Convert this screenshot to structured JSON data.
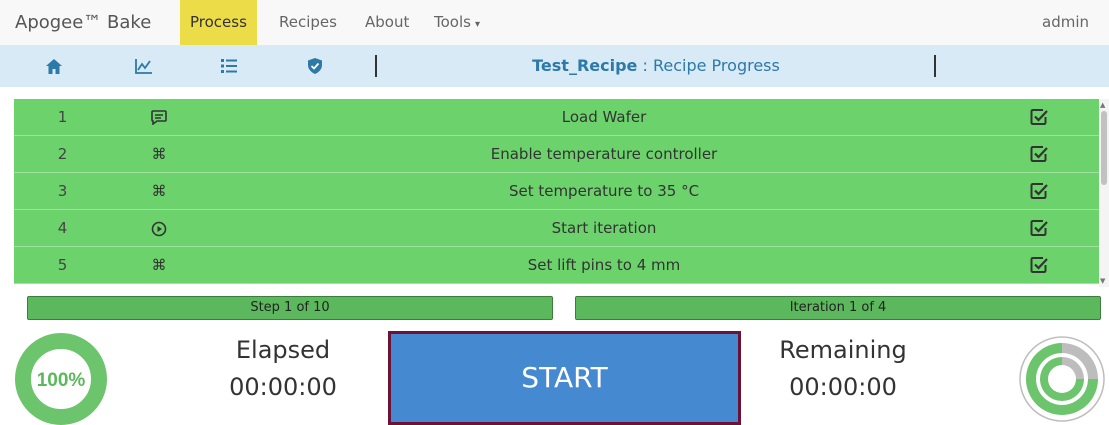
{
  "navbar": {
    "brand": "Apogee™ Bake",
    "items": [
      {
        "label": "Process",
        "active": true
      },
      {
        "label": "Recipes",
        "active": false
      },
      {
        "label": "About",
        "active": false
      },
      {
        "label": "Tools",
        "active": false,
        "has_dropdown": true
      }
    ],
    "user": "admin",
    "active_color": "#ecdc48"
  },
  "toolbar": {
    "icons": [
      "home-icon",
      "chart-icon",
      "list-icon",
      "shield-check-icon"
    ],
    "recipe_name": "Test_Recipe",
    "separator": ":",
    "view_title": "Recipe Progress"
  },
  "steps": [
    {
      "number": "1",
      "type_icon": "message-icon",
      "glyph": "⊟",
      "description": "Load Wafer",
      "status_icon": "checked-icon"
    },
    {
      "number": "2",
      "type_icon": "command-icon",
      "glyph": "⌘",
      "description": "Enable temperature controller",
      "status_icon": "checked-icon"
    },
    {
      "number": "3",
      "type_icon": "command-icon",
      "glyph": "⌘",
      "description": "Set temperature to 35 °C",
      "status_icon": "checked-icon"
    },
    {
      "number": "4",
      "type_icon": "play-circle-icon",
      "glyph": "⊙",
      "description": "Start iteration",
      "status_icon": "checked-icon"
    },
    {
      "number": "5",
      "type_icon": "command-icon",
      "glyph": "⌘",
      "description": "Set lift pins to 4 mm",
      "status_icon": "checked-icon"
    }
  ],
  "progress": {
    "step_text": "Step 1 of 10",
    "iteration_text": "Iteration 1 of 4",
    "percent_text": "100%",
    "percent_value": 100
  },
  "timers": {
    "elapsed_label": "Elapsed",
    "elapsed_value": "00:00:00",
    "remaining_label": "Remaining",
    "remaining_value": "00:00:00"
  },
  "start_button": {
    "label": "START"
  },
  "colors": {
    "row_green": "#6cd36c",
    "bar_green": "#5cb85c",
    "toolbar_blue": "#d7eaf6",
    "title_blue": "#2d79a8",
    "start_blue": "#4589d1",
    "start_border": "#6b1236"
  }
}
